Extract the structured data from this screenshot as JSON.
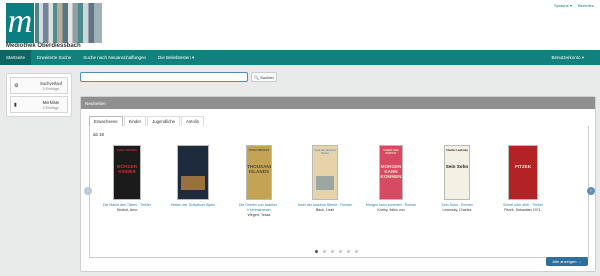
{
  "header": {
    "logo_text": "Mediothek Oberdiessbach",
    "links": [
      "Sprache ▾",
      "Beenden"
    ]
  },
  "nav": {
    "items": [
      "Startseite",
      "Erweiterte Suche",
      "Suche nach Neuanschaffungen",
      "Die Beliebtesten ▾"
    ],
    "user": "Benutzerkonto ▾"
  },
  "sidebar": {
    "items": [
      {
        "title": "Suchverlauf",
        "sub": "0 Einträge",
        "icon": "gear-icon"
      },
      {
        "title": "Merkliste",
        "sub": "0 Einträge",
        "icon": "bookmark-icon"
      }
    ]
  },
  "search": {
    "placeholder": "",
    "button_label": "Suchen"
  },
  "panel": {
    "title": "Neuheiten",
    "tabs": [
      "Erwachsene",
      "Kinder",
      "Jugendliche",
      "Antolin"
    ],
    "age_label": "ab 18",
    "show_all": "Alle anzeigen →",
    "page_count": 6,
    "active_page": 0
  },
  "books": [
    {
      "title": "Die Macht des Täters : Thriller",
      "author": "Strobel, Arno",
      "cover_color": "#1b1b1b",
      "accent": "#c92b2b",
      "cover_text": "MÖRDER KINDER",
      "cover_top": "ARNO STROBEL"
    },
    {
      "title": "Hütten der Schweizer Alpen",
      "author": "",
      "cover_color": "#1e2b3d",
      "accent": "#e9a040",
      "cover_text": "",
      "cover_top": ""
    },
    {
      "title": "Die Gestirn von Iwanton : Kriminalroman",
      "author": "Wegert, Tessa",
      "cover_color": "#c4a454",
      "accent": "#4d4a3a",
      "cover_text": "THOUSAND ISLANDS",
      "cover_top": "TESSA WEGERT"
    },
    {
      "title": "Insel der tausend Sterne : Roman",
      "author": "Bach, Leah",
      "cover_color": "#e6d3a9",
      "accent": "#6a8b9c",
      "cover_text": "",
      "cover_top": "Insel der tausend Sterne"
    },
    {
      "title": "Morgen kann kommen : Roman",
      "author": "Kürthy, Ildikó von",
      "cover_color": "#d84a64",
      "accent": "#f1e5c8",
      "cover_text": "MORGEN KANN KOMMEN",
      "cover_top": "ILDIKÓ VON KÜRTHY"
    },
    {
      "title": "Sein Sohn : Roman",
      "author": "Lewinsky, Charles",
      "cover_color": "#f5f0e4",
      "accent": "#1c1c1c",
      "cover_text": "Sein Sohn",
      "cover_top": "Charles Lewinsky"
    },
    {
      "title": "Schrei oder stirb : Thriller",
      "author": "Fitzek, Sebastian 1971-",
      "cover_color": "#b32225",
      "accent": "#f3e6d0",
      "cover_text": "FITZEK",
      "cover_top": ""
    }
  ]
}
